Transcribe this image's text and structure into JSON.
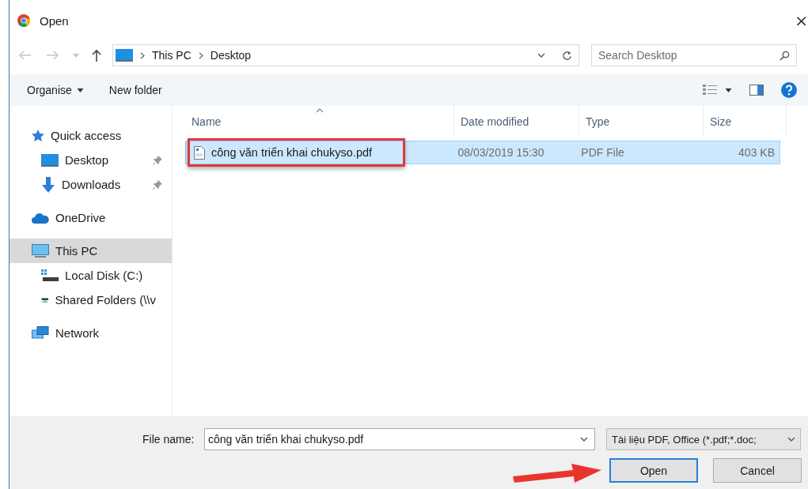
{
  "window": {
    "title": "Open",
    "close": "×"
  },
  "address": {
    "path": [
      "This PC",
      "Desktop"
    ]
  },
  "search": {
    "placeholder": "Search Desktop"
  },
  "toolbar": {
    "organise": "Organise",
    "new_folder": "New folder"
  },
  "sidebar": {
    "items": [
      {
        "label": "Quick access",
        "kind": "star",
        "selected": false,
        "children": [
          {
            "label": "Desktop",
            "kind": "desktop",
            "selected": false,
            "pinned": true
          },
          {
            "label": "Downloads",
            "kind": "download",
            "selected": false,
            "pinned": true
          }
        ]
      },
      {
        "label": "OneDrive",
        "kind": "cloud",
        "selected": false
      },
      {
        "label": "This PC",
        "kind": "pc",
        "selected": true,
        "children": [
          {
            "label": "Local Disk (C:)",
            "kind": "disk",
            "selected": false
          },
          {
            "label": "Shared Folders (\\\\v",
            "kind": "share",
            "selected": false
          }
        ]
      },
      {
        "label": "Network",
        "kind": "network",
        "selected": false
      }
    ]
  },
  "table": {
    "columns": [
      {
        "label": "Name",
        "sorted": true
      },
      {
        "label": "Date modified",
        "sorted": false
      },
      {
        "label": "Type",
        "sorted": false
      },
      {
        "label": "Size",
        "sorted": false
      }
    ],
    "rows": [
      {
        "name": "công văn triển khai chukyso.pdf",
        "date": "08/03/2019 15:30",
        "type": "PDF File",
        "size": "403 KB",
        "selected": true
      }
    ]
  },
  "footer": {
    "file_name_label": "File name:",
    "file_name": "công văn triển khai chukyso.pdf",
    "file_type": "Tài liệu PDF, Office (*.pdf;*.doc;",
    "buttons": [
      {
        "label": "Open",
        "default": true
      },
      {
        "label": "Cancel",
        "default": false
      }
    ]
  }
}
